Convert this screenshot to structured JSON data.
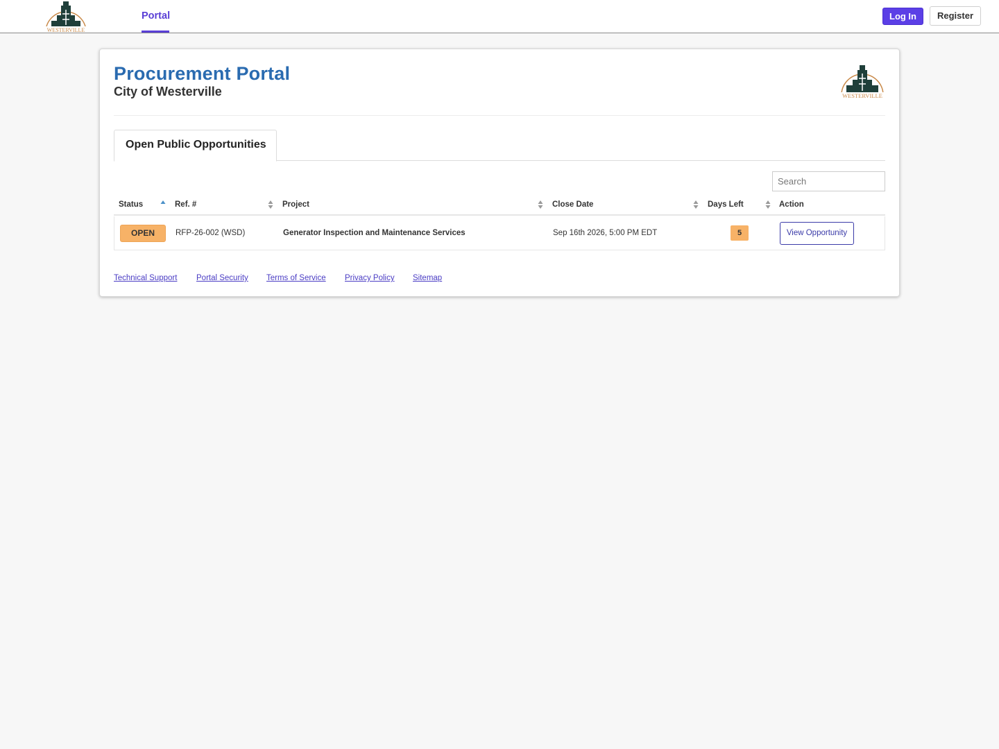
{
  "nav": {
    "logo_text": "WESTERVILLE",
    "portal_tab": "Portal",
    "login_label": "Log In",
    "register_label": "Register"
  },
  "header": {
    "title": "Procurement Portal",
    "subtitle": "City of Westerville",
    "logo_text": "WESTERVILLE"
  },
  "tabs": {
    "active_label": "Open Public Opportunities"
  },
  "search": {
    "placeholder": "Search",
    "value": ""
  },
  "table": {
    "columns": [
      "Status",
      "Ref. #",
      "Project",
      "Close Date",
      "Days Left",
      "Action"
    ],
    "rows": [
      {
        "status": "OPEN",
        "ref": "RFP-26-002 (WSD)",
        "project": "Generator Inspection and Maintenance Services",
        "close_date": "Sep 16th 2026, 5:00 PM EDT",
        "days_left": "5",
        "action": "View Opportunity"
      }
    ]
  },
  "footer": {
    "links": [
      "Technical Support",
      "Portal Security",
      "Terms of Service",
      "Privacy Policy",
      "Sitemap"
    ]
  },
  "colors": {
    "brand_blue": "#2a6bb0",
    "accent_purple": "#5b3fe6",
    "status_orange": "#f7b267"
  }
}
